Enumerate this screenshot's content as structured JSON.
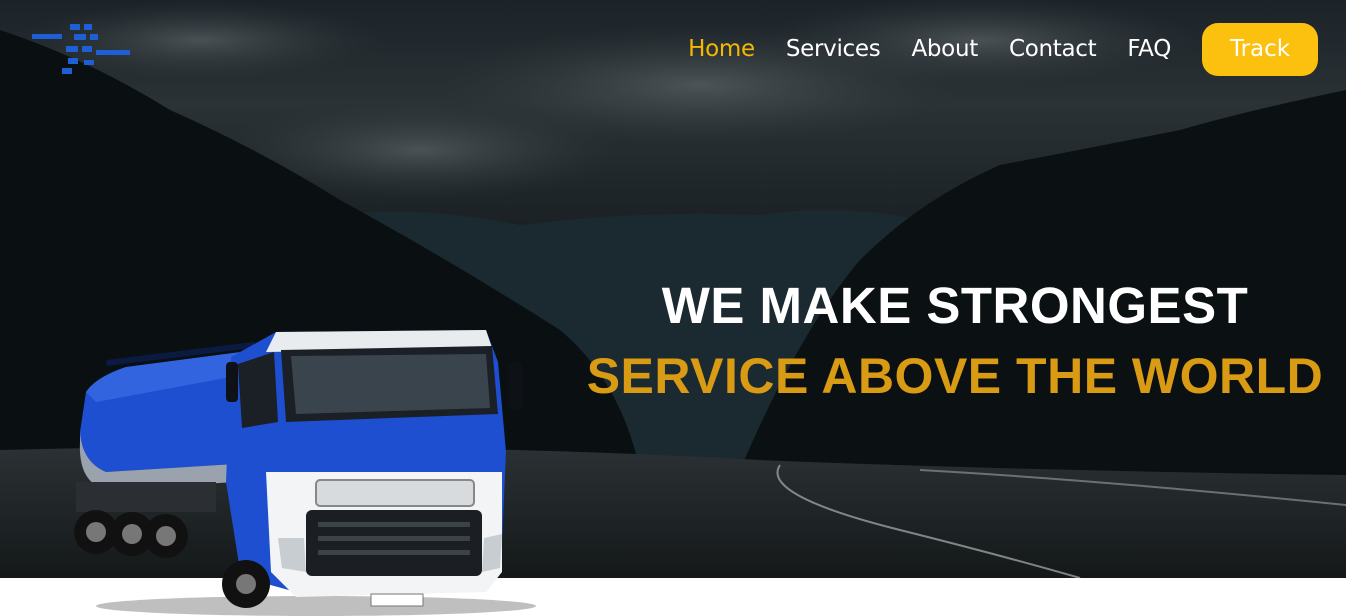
{
  "nav": {
    "items": [
      {
        "label": "Home",
        "active": true
      },
      {
        "label": "Services",
        "active": false
      },
      {
        "label": "About",
        "active": false
      },
      {
        "label": "Contact",
        "active": false
      },
      {
        "label": "FAQ",
        "active": false
      }
    ],
    "track_label": "Track"
  },
  "hero": {
    "headline_line1": "WE MAKE STRONGEST",
    "headline_line2": "SERVICE ABOVE THE WORLD"
  },
  "colors": {
    "accent_yellow": "#fcc10f",
    "headline_gold": "#d99a14",
    "logo_blue": "#1f5fd6",
    "truck_blue": "#1e4fd0"
  },
  "icons": {
    "logo": "pixel-dash-logo-icon"
  }
}
